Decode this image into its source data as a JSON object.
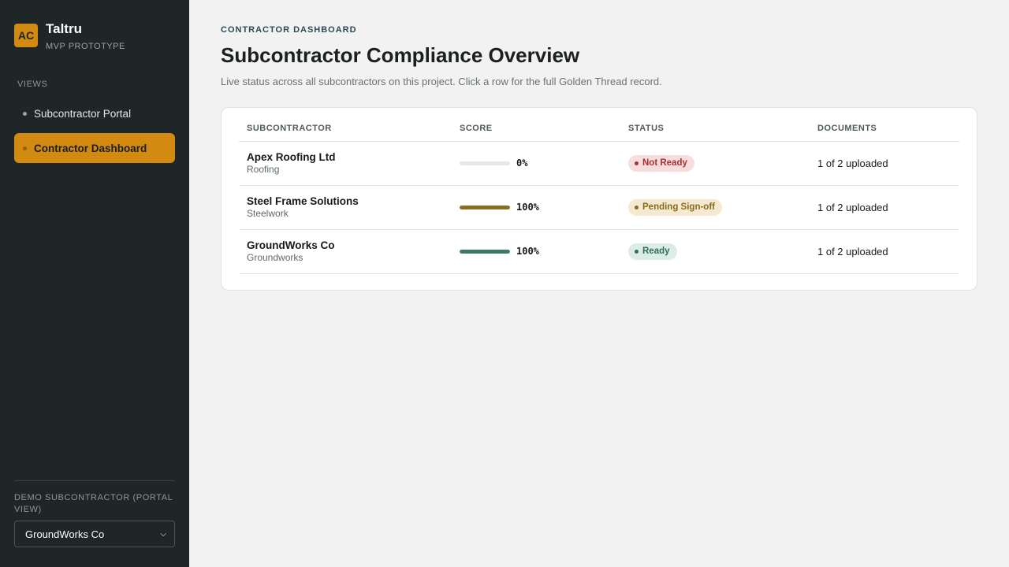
{
  "sidebar": {
    "logo_initials": "AC",
    "app_name": "Taltru",
    "app_tagline": "MVP PROTOTYPE",
    "views_label": "VIEWS",
    "nav": [
      {
        "label": "Subcontractor Portal",
        "active": false
      },
      {
        "label": "Contractor Dashboard",
        "active": true
      }
    ],
    "demo_label": "DEMO SUBCONTRACTOR (PORTAL VIEW)",
    "demo_selected": "GroundWorks Co"
  },
  "header": {
    "eyebrow": "CONTRACTOR DASHBOARD",
    "title": "Subcontractor Compliance Overview",
    "subtitle": "Live status across all subcontractors on this project. Click a row for the full Golden Thread record."
  },
  "table": {
    "columns": [
      "SUBCONTRACTOR",
      "SCORE",
      "STATUS",
      "DOCUMENTS"
    ],
    "rows": [
      {
        "name": "Apex Roofing Ltd",
        "trade": "Roofing",
        "score_label": "0%",
        "score": 0,
        "bar_color": "#e2e3e3",
        "status": "Not Ready",
        "status_bg": "#f7dddd",
        "status_fg": "#a8322f",
        "documents": "1 of 2 uploaded"
      },
      {
        "name": "Steel Frame Solutions",
        "trade": "Steelwork",
        "score_label": "100%",
        "score": 100,
        "bar_color": "#8a6d1e",
        "status": "Pending Sign-off",
        "status_bg": "#f5e9cf",
        "status_fg": "#8a6a1e",
        "documents": "1 of 2 uploaded"
      },
      {
        "name": "GroundWorks Co",
        "trade": "Groundworks",
        "score_label": "100%",
        "score": 100,
        "bar_color": "#3d7a64",
        "status": "Ready",
        "status_bg": "#dcede5",
        "status_fg": "#2f6e57",
        "documents": "1 of 2 uploaded"
      }
    ]
  },
  "colors": {
    "accent": "#d28a10",
    "sidebar_bg": "#1f2627",
    "page_bg": "#f1f2f1"
  }
}
